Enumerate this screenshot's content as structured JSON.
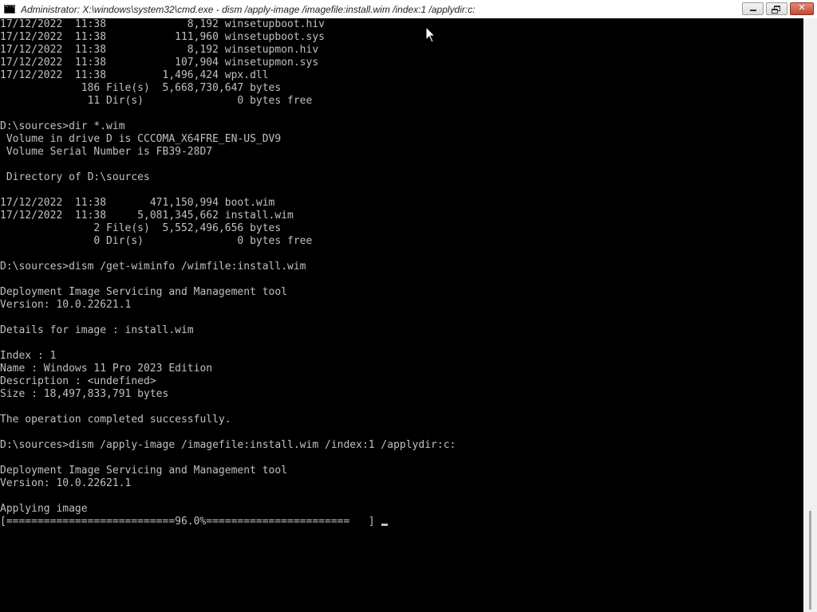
{
  "window": {
    "title": "Administrator: X:\\windows\\system32\\cmd.exe - dism  /apply-image /imagefile:install.wim /index:1 /applydir:c:",
    "icon": "cmd-icon",
    "controls": {
      "minimize": "minimize-icon",
      "restore": "restore-icon",
      "close": "close-icon",
      "close_glyph": "✕"
    }
  },
  "console": {
    "lines": [
      "17/12/2022  11:38             8,192 winsetupboot.hiv",
      "17/12/2022  11:38           111,960 winsetupboot.sys",
      "17/12/2022  11:38             8,192 winsetupmon.hiv",
      "17/12/2022  11:38           107,904 winsetupmon.sys",
      "17/12/2022  11:38         1,496,424 wpx.dll",
      "             186 File(s)  5,668,730,647 bytes",
      "              11 Dir(s)               0 bytes free",
      "",
      "D:\\sources>dir *.wim",
      " Volume in drive D is CCCOMA_X64FRE_EN-US_DV9",
      " Volume Serial Number is FB39-28D7",
      "",
      " Directory of D:\\sources",
      "",
      "17/12/2022  11:38       471,150,994 boot.wim",
      "17/12/2022  11:38     5,081,345,662 install.wim",
      "               2 File(s)  5,552,496,656 bytes",
      "               0 Dir(s)               0 bytes free",
      "",
      "D:\\sources>dism /get-wiminfo /wimfile:install.wim",
      "",
      "Deployment Image Servicing and Management tool",
      "Version: 10.0.22621.1",
      "",
      "Details for image : install.wim",
      "",
      "Index : 1",
      "Name : Windows 11 Pro 2023 Edition",
      "Description : <undefined>",
      "Size : 18,497,833,791 bytes",
      "",
      "The operation completed successfully.",
      "",
      "D:\\sources>dism /apply-image /imagefile:install.wim /index:1 /applydir:c:",
      "",
      "Deployment Image Servicing and Management tool",
      "Version: 10.0.22621.1",
      "",
      "Applying image",
      "[===========================96.0%=======================   ]"
    ],
    "progress_percent": 96.0
  },
  "colors": {
    "console_bg": "#000000",
    "console_fg": "#c0c0c0",
    "titlebar_bg": "#ffffff",
    "close_button": "#c24a34"
  }
}
